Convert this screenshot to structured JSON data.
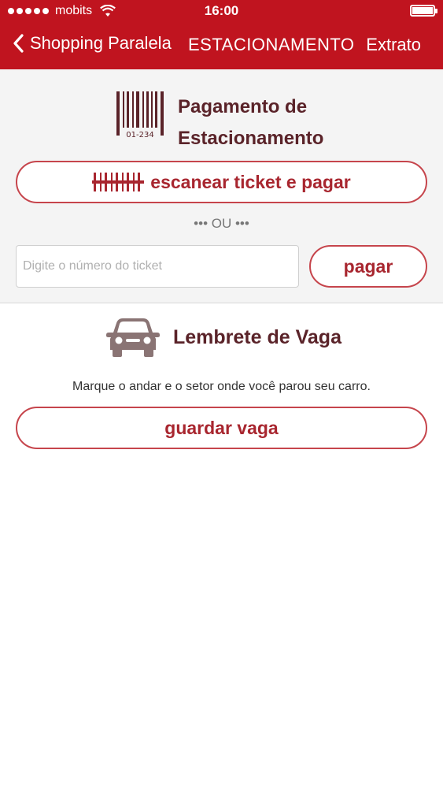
{
  "status_bar": {
    "carrier": "mobits",
    "time": "16:00",
    "icons": [
      "signal-dots-icon",
      "wifi-icon",
      "battery-icon"
    ]
  },
  "navbar": {
    "back_label": "Shopping Paralela",
    "title": "ESTACIONAMENTO",
    "right_label": "Extrato",
    "color": "#c0141f"
  },
  "payment": {
    "title": "Pagamento de Estacionamento",
    "title_line1": "Pagamento de",
    "title_line2": "Estacionamento",
    "barcode_number": "01-234",
    "scan_button": "escanear ticket e pagar",
    "separator": "••• OU •••",
    "ticket_input": {
      "value": "",
      "placeholder": "Digite o número do ticket"
    },
    "pay_button": "pagar"
  },
  "parking_reminder": {
    "title": "Lembrete de Vaga",
    "description": "Marque o andar e o setor onde você parou seu carro.",
    "save_button": "guardar vaga"
  },
  "colors": {
    "accent": "#c0141f",
    "button_text": "#a8262f",
    "heading": "#5a2329"
  }
}
